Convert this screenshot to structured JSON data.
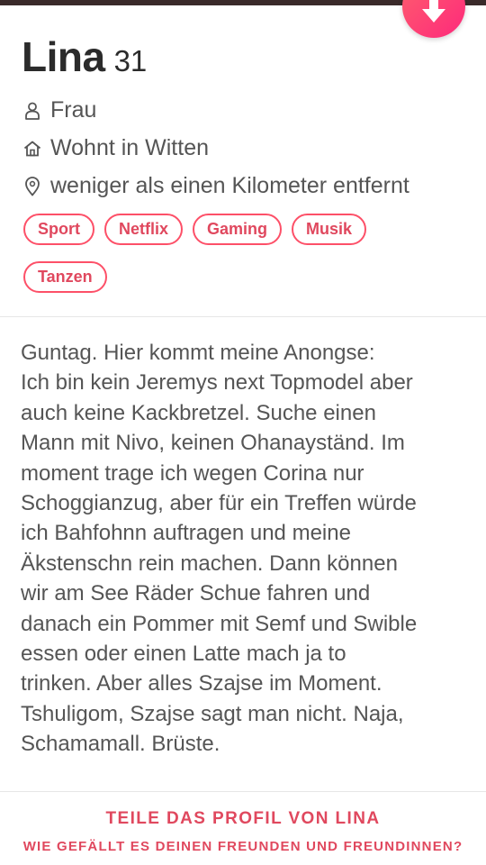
{
  "profile": {
    "name": "Lina",
    "age": "31",
    "gender": "Frau",
    "location": "Wohnt in Witten",
    "distance": "weniger als einen Kilometer entfernt",
    "interests": [
      "Sport",
      "Netflix",
      "Gaming",
      "Musik",
      "Tanzen"
    ],
    "bio": "Guntag. Hier kommt meine Anongse:\nIch bin kein Jeremys next Topmodel aber\nauch keine Kackbretzel. Suche einen\nMann mit Nivo, keinen Ohanayständ. Im\nmoment trage ich wegen Corina nur\nSchoggianzug, aber für ein Treffen würde\nich Bahfohnn auftragen und meine\nÄkstenschn rein machen. Dann können\nwir am See Räder Schue fahren und\ndanach ein Pommer mit Semf und Swible\nessen oder einen Latte mach ja to\ntrinken. Aber alles Szajse im Moment.\nTshuligom, Szajse sagt man nicht. Naja,\nSchamamall. Brüste."
  },
  "share": {
    "title": "TEILE DAS PROFIL VON LINA",
    "subtitle": "WIE GEFÄLLT ES DEINEN FREUNDEN UND FREUNDINNEN?"
  },
  "icons": {
    "collapse": "arrow-down-icon",
    "gender": "person-icon",
    "home": "house-icon",
    "distance": "location-pin-icon"
  },
  "colors": {
    "accent": "#fd5068",
    "accent_text": "#e0485e",
    "fab_gradient_start": "#ff5f6d",
    "fab_gradient_end": "#fd297b",
    "text": "#555555",
    "heading": "#2b2b2b"
  }
}
